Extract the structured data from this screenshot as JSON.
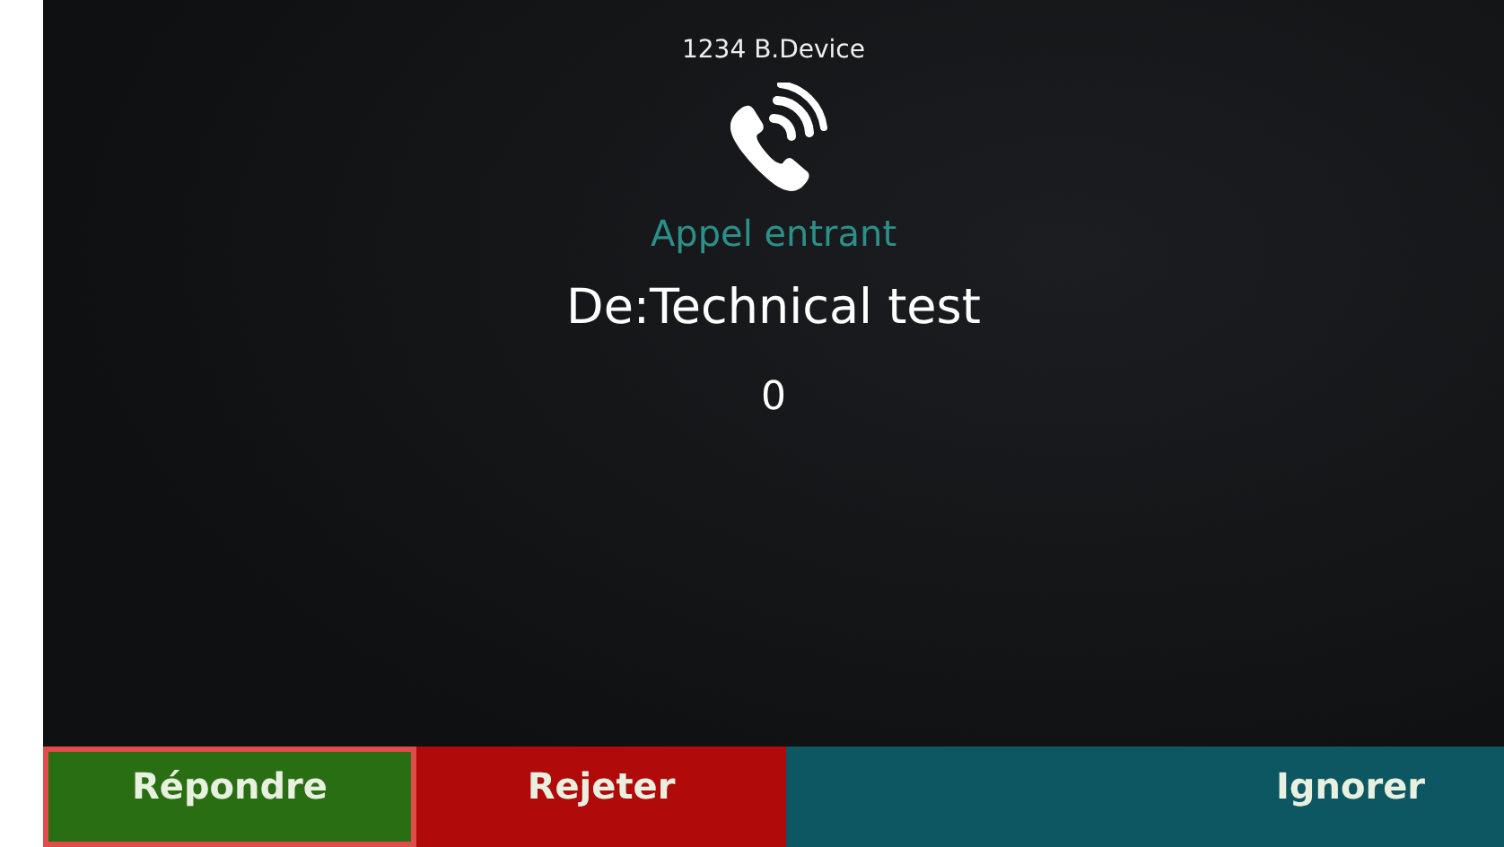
{
  "header": {
    "title": "1234 B.Device"
  },
  "call": {
    "status": "Appel entrant",
    "caller": "De:Technical test",
    "timer": "0"
  },
  "softkeys": [
    {
      "label": "Répondre",
      "color": "#2a6e14",
      "highlighted": true
    },
    {
      "label": "Rejeter",
      "color": "#b10a0a",
      "highlighted": false
    },
    {
      "label": "Ignorer",
      "color": "#0d5763",
      "highlighted": false
    }
  ]
}
